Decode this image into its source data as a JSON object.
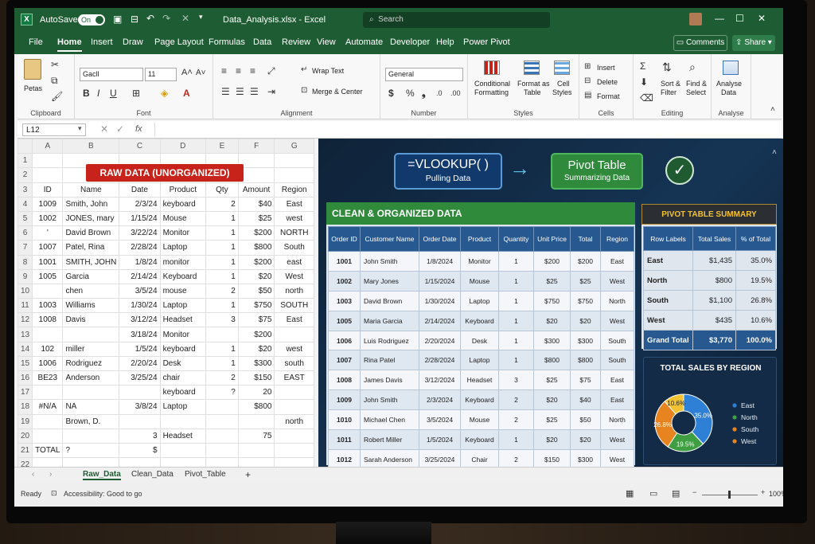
{
  "app": {
    "autosave_label": "AutoSave",
    "autosave_state": "On",
    "filename": "Data_Analysis.xlsx",
    "separator": "-",
    "app_name": "Excel",
    "search_placeholder": "Search",
    "comments_label": "Comments",
    "share_label": "Share"
  },
  "tabs": [
    "File",
    "Home",
    "Insert",
    "Draw",
    "Page Layout",
    "Formulas",
    "Data",
    "Review",
    "View",
    "Automate",
    "Developer",
    "Help",
    "Power Pivot"
  ],
  "ribbon": {
    "clipboard": {
      "paste": "Petas",
      "label": "Clipboard"
    },
    "font": {
      "name": "Gacll",
      "size": "11",
      "label": "Font"
    },
    "alignment": {
      "wrap": "Wrap Text",
      "merge": "Merge & Center",
      "label": "Alignment"
    },
    "number": {
      "format": "General",
      "label": "Number"
    },
    "styles": {
      "cond_line1": "Conditional",
      "cond_line2": "Formatting",
      "table_line1": "Format as",
      "table_line2": "Table",
      "cell_line1": "Cell",
      "cell_line2": "Styles",
      "label": "Styles"
    },
    "cells": {
      "insert": "Insert",
      "delete": "Delete",
      "format": "Format",
      "label": "Cells"
    },
    "editing": {
      "sort_line1": "Sort &",
      "sort_line2": "Filter",
      "find_line1": "Find &",
      "find_line2": "Select",
      "label": "Editing"
    },
    "analysis": {
      "line1": "Analyse",
      "line2": "Data",
      "label": "Analyse"
    }
  },
  "formula_bar": {
    "name_box": "L12",
    "fx": "fx"
  },
  "raw": {
    "banner": "RAW DATA (UNORGANIZED)",
    "col_headers": [
      "A",
      "B",
      "C",
      "D",
      "E",
      "F",
      "G"
    ],
    "rows": [
      [
        "",
        "",
        "",
        "",
        "",
        "",
        ""
      ],
      [
        "",
        "",
        "",
        "",
        "",
        "",
        ""
      ],
      [
        "ID",
        "Name",
        "Date",
        "Product",
        "Qty",
        "Amount",
        "Region"
      ],
      [
        "1009",
        "Smith, John",
        "2/3/24",
        "keyboard",
        "2",
        "$40",
        "East"
      ],
      [
        "1002",
        "JONES, mary",
        "1/15/24",
        "Mouse",
        "1",
        "$25",
        "west"
      ],
      [
        "'",
        "David Brown",
        "3/22/24",
        "Monitor",
        "1",
        "$200",
        "NORTH"
      ],
      [
        "1007",
        "Patel, Rina",
        "2/28/24",
        "Laptop",
        "1",
        "$800",
        "South"
      ],
      [
        "1001",
        "SMITH, JOHN",
        "1/8/24",
        "monitor",
        "1",
        "$200",
        "east"
      ],
      [
        "1005",
        "Garcia",
        "2/14/24",
        "Keyboard",
        "1",
        "$20",
        "West"
      ],
      [
        "",
        "chen",
        "3/5/24",
        "mouse",
        "2",
        "$50",
        "north"
      ],
      [
        "1003",
        "Williams",
        "1/30/24",
        "Laptop",
        "1",
        "$750",
        "SOUTH"
      ],
      [
        "1008",
        "Davis",
        "3/12/24",
        "Headset",
        "3",
        "$75",
        "East"
      ],
      [
        "",
        "",
        "3/18/24",
        "Monitor",
        "",
        "$200",
        ""
      ],
      [
        "102",
        "miller",
        "1/5/24",
        "keyboard",
        "1",
        "$20",
        "west"
      ],
      [
        "1006",
        "Rodriguez",
        "2/20/24",
        "Desk",
        "1",
        "$300",
        "south"
      ],
      [
        "BE23",
        "Anderson",
        "3/25/24",
        "chair",
        "2",
        "$150",
        "EAST"
      ],
      [
        "",
        "",
        "",
        "keyboard",
        "?",
        "20",
        ""
      ],
      [
        "#N/A",
        "NA",
        "3/8/24",
        "Laptop",
        "",
        "$800",
        ""
      ],
      [
        "",
        "Brown, D.",
        "",
        "",
        "",
        "",
        "north"
      ],
      [
        "",
        "",
        "3",
        "Headset",
        "",
        "75",
        ""
      ],
      [
        "TOTAL",
        "?",
        "$",
        "",
        "",
        "",
        ""
      ],
      [
        "",
        "",
        "",
        "",
        "",
        "",
        ""
      ]
    ]
  },
  "process": {
    "vlookup": "=VLOOKUP( )",
    "vlookup_sub": "Pulling Data",
    "arrow": "→",
    "pivot": "Pivot Table",
    "pivot_sub": "Summarizing Data",
    "check": "✓"
  },
  "clean": {
    "title": "CLEAN & ORGANIZED DATA",
    "headers": [
      "Order ID",
      "Customer Name",
      "Order Date",
      "Product",
      "Quantity",
      "Unit Price",
      "Total",
      "Region"
    ],
    "rows": [
      [
        "1001",
        "John Smith",
        "1/8/2024",
        "Monitor",
        "1",
        "$200",
        "$200",
        "East"
      ],
      [
        "1002",
        "Mary Jones",
        "1/15/2024",
        "Mouse",
        "1",
        "$25",
        "$25",
        "West"
      ],
      [
        "1003",
        "David Brown",
        "1/30/2024",
        "Laptop",
        "1",
        "$750",
        "$750",
        "North"
      ],
      [
        "1005",
        "Maria Garcia",
        "2/14/2024",
        "Keyboard",
        "1",
        "$20",
        "$20",
        "West"
      ],
      [
        "1006",
        "Luis Rodriguez",
        "2/20/2024",
        "Desk",
        "1",
        "$300",
        "$300",
        "South"
      ],
      [
        "1007",
        "Rina Patel",
        "2/28/2024",
        "Laptop",
        "1",
        "$800",
        "$800",
        "South"
      ],
      [
        "1008",
        "James Davis",
        "3/12/2024",
        "Headset",
        "3",
        "$25",
        "$75",
        "East"
      ],
      [
        "1009",
        "John Smith",
        "2/3/2024",
        "Keyboard",
        "2",
        "$20",
        "$40",
        "East"
      ],
      [
        "1010",
        "Michael Chen",
        "3/5/2024",
        "Mouse",
        "2",
        "$25",
        "$50",
        "North"
      ],
      [
        "1011",
        "Robert Miller",
        "1/5/2024",
        "Keyboard",
        "1",
        "$20",
        "$20",
        "West"
      ],
      [
        "1012",
        "Sarah Anderson",
        "3/25/2024",
        "Chair",
        "2",
        "$150",
        "$300",
        "West"
      ]
    ]
  },
  "pivot": {
    "title": "PIVOT TABLE SUMMARY",
    "headers": [
      "Row Labels",
      "Total Sales",
      "% of Total"
    ],
    "rows": [
      [
        "East",
        "$1,435",
        "35.0%"
      ],
      [
        "North",
        "$800",
        "19.5%"
      ],
      [
        "South",
        "$1,100",
        "26.8%"
      ],
      [
        "West",
        "$435",
        "10.6%"
      ]
    ],
    "total": [
      "Grand Total",
      "$3,770",
      "100.0%"
    ]
  },
  "chart_data": {
    "type": "pie",
    "title": "TOTAL SALES BY REGION",
    "categories": [
      "East",
      "North",
      "South",
      "West"
    ],
    "values": [
      35.0,
      19.5,
      26.8,
      10.6
    ],
    "labels": [
      "35.0%",
      "19.5%",
      "26.8%",
      "10.6%"
    ],
    "colors": [
      "#2e7fd6",
      "#3f9e42",
      "#e8841f",
      "#f2c233"
    ],
    "legend_colors": [
      "#2e7fd6",
      "#3f9e42",
      "#e8841f",
      "#e8841f"
    ],
    "legend": "right"
  },
  "sheet_tabs": [
    "Raw_Data",
    "Clean_Data",
    "Pivot_Table"
  ],
  "status": {
    "ready": "Ready",
    "accessibility": "Accessibility: Good to go",
    "zoom": "100%"
  }
}
